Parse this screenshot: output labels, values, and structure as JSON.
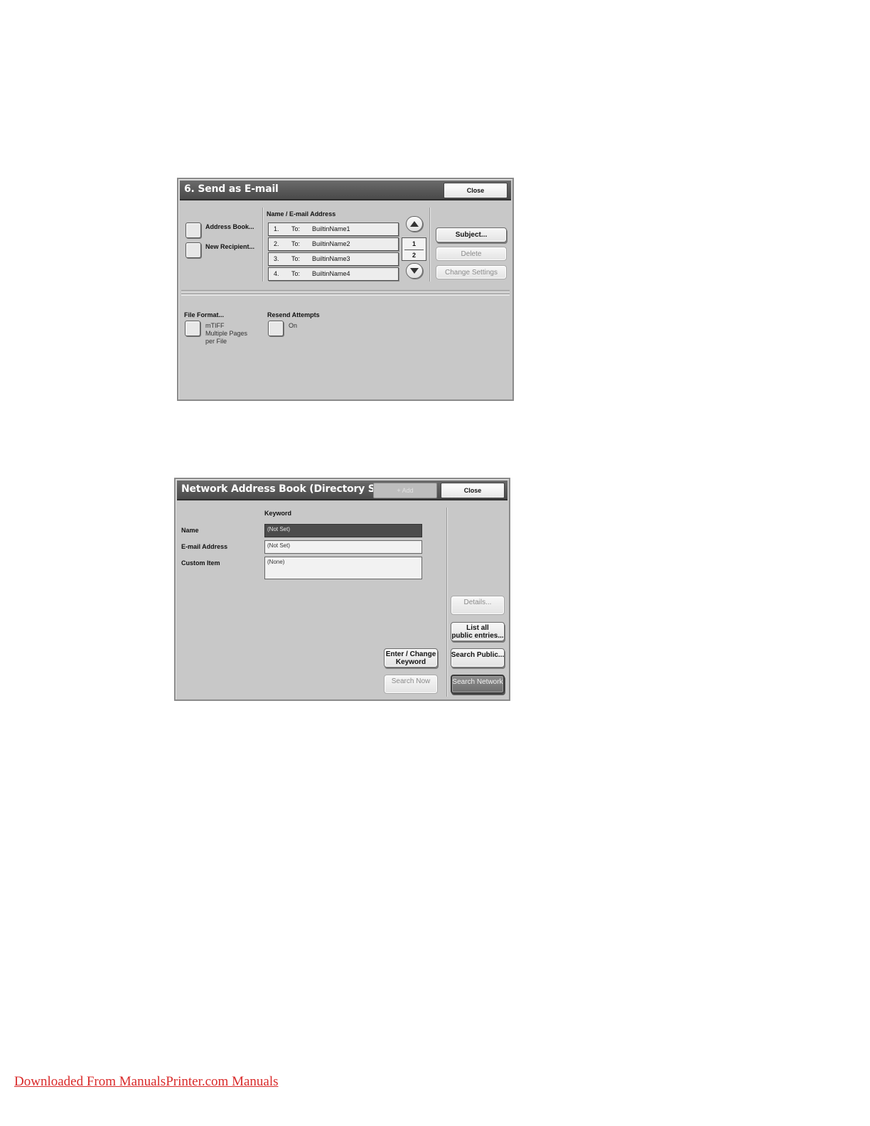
{
  "send_email_panel": {
    "title": "6. Send as E-mail",
    "close_label": "Close",
    "address_book_label": "Address Book...",
    "new_recipient_label": "New Recipient...",
    "list_header": "Name / E-mail Address",
    "recipients": [
      {
        "num": "1.",
        "type": "To:",
        "name": "BuiltinName1"
      },
      {
        "num": "2.",
        "type": "To:",
        "name": "BuiltinName2"
      },
      {
        "num": "3.",
        "type": "To:",
        "name": "BuiltinName3"
      },
      {
        "num": "4.",
        "type": "To:",
        "name": "BuiltinName4"
      }
    ],
    "page_current": "1",
    "page_total": "2",
    "subject_label": "Subject...",
    "delete_label": "Delete",
    "change_settings_label": "Change Settings",
    "file_format_label": "File Format...",
    "file_format_value": [
      "mTIFF",
      "Multiple Pages",
      "per File"
    ],
    "resend_label": "Resend Attempts",
    "resend_value": "On"
  },
  "network_book_panel": {
    "title": "Network Address Book (Directory Service)",
    "add_label": "+ Add",
    "close_label": "Close",
    "keyword_header": "Keyword",
    "fields": [
      {
        "label": "Name",
        "value": "(Not Set)"
      },
      {
        "label": "E-mail Address",
        "value": "(Not Set)"
      },
      {
        "label": "Custom Item",
        "value": "(None)"
      }
    ],
    "details_label": "Details...",
    "list_all_label": [
      "List all",
      "public entries..."
    ],
    "search_public_label": "Search Public...",
    "search_network_label": "Search Network",
    "enter_change_keyword_label": [
      "Enter / Change",
      "Keyword"
    ],
    "search_now_label": "Search Now"
  },
  "footer_link": "Downloaded From ManualsPrinter.com Manuals"
}
